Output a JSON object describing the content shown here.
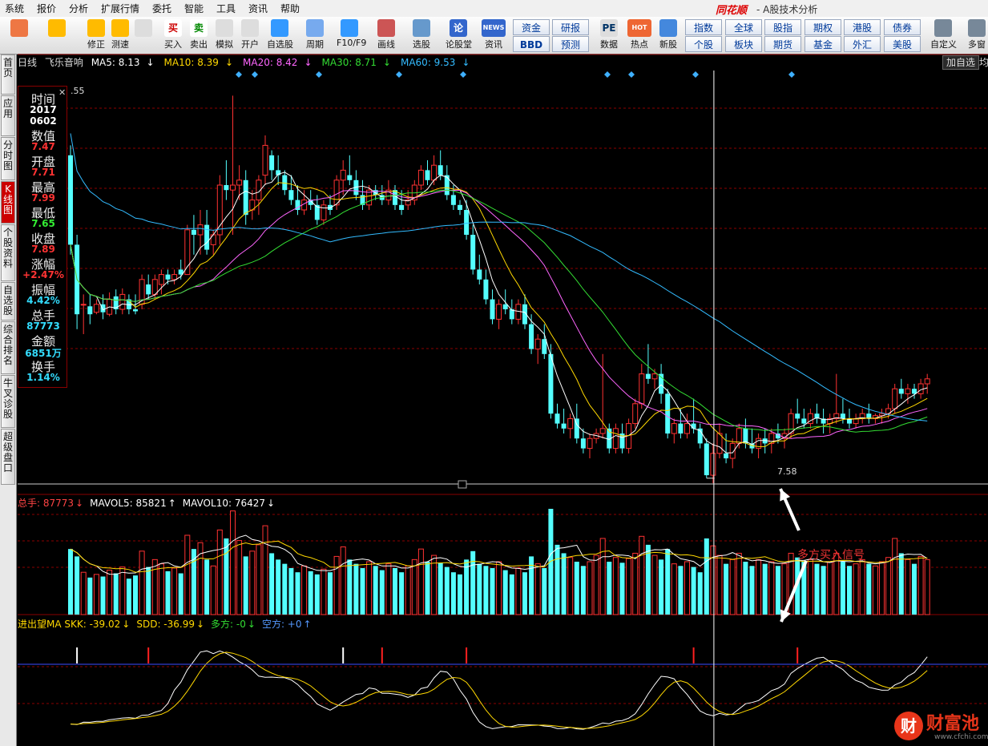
{
  "menu": [
    "系统",
    "报价",
    "分析",
    "扩展行情",
    "委托",
    "智能",
    "工具",
    "资讯",
    "帮助"
  ],
  "brand": "同花顺",
  "window_title": "- A股技术分析",
  "toolbar": {
    "tools": [
      {
        "label": "",
        "icon": "grid-icon"
      },
      {
        "label": "",
        "icon": "back-arrow-icon"
      },
      {
        "label": "修正",
        "icon": "up-down-arrow-icon"
      },
      {
        "label": "测速",
        "icon": "power-icon"
      },
      {
        "label": "",
        "icon": "clock-icon"
      },
      {
        "label": "买入",
        "icon": "buy-icon",
        "glyph": "买"
      },
      {
        "label": "卖出",
        "icon": "sell-icon",
        "glyph": "卖"
      },
      {
        "label": "模拟",
        "icon": "gavel-icon"
      },
      {
        "label": "开户",
        "icon": "lock-icon"
      },
      {
        "label": "自选股",
        "icon": "star-icon"
      },
      {
        "label": "周期",
        "icon": "cycle-icon"
      },
      {
        "label": "F10/F9",
        "icon": "f10-icon"
      },
      {
        "label": "画线",
        "icon": "pen-icon"
      },
      {
        "label": "选股",
        "icon": "monitor-icon"
      },
      {
        "label": "论股堂",
        "icon": "forum-icon",
        "glyph": "论"
      },
      {
        "label": "资讯",
        "icon": "news-icon",
        "glyph": "NEWS"
      },
      {
        "label": "数据",
        "icon": "pe-icon",
        "glyph": "PE"
      },
      {
        "label": "热点",
        "icon": "hot-icon",
        "glyph": "HOT"
      },
      {
        "label": "新股",
        "icon": "new-stock-icon"
      },
      {
        "label": "自定义",
        "icon": "custom-icon"
      },
      {
        "label": "多窗",
        "icon": "multi-window-icon"
      }
    ],
    "quick_row1": [
      "资金",
      "研报",
      "指数",
      "全球",
      "股指",
      "期权",
      "港股",
      "债券"
    ],
    "quick_row2": [
      "BBD",
      "预测",
      "个股",
      "板块",
      "期货",
      "基金",
      "外汇",
      "美股"
    ]
  },
  "sidebar": [
    "首页",
    "应用",
    "分时图",
    "K线图",
    "个股资料",
    "自选股",
    "综合排名",
    "牛叉诊股",
    "超级盘口"
  ],
  "chart_header": {
    "period": "日线",
    "stock": "飞乐音响",
    "ma": [
      {
        "label": "MA5: 8.13",
        "arrow": "↓",
        "color": "#ffffff"
      },
      {
        "label": "MA10: 8.39",
        "arrow": "↓",
        "color": "#ffd800"
      },
      {
        "label": "MA20: 8.42",
        "arrow": "↓",
        "color": "#ff66ff"
      },
      {
        "label": "MA30: 8.71",
        "arrow": "↓",
        "color": "#33dd33"
      },
      {
        "label": "MA60: 9.53",
        "arrow": "↓",
        "color": "#33bbff"
      }
    ],
    "add_fav": "加自选",
    "add_fav2": "均"
  },
  "price_top_label": ".55",
  "info_panel": [
    {
      "k": "时间",
      "v": "2017\n0602",
      "color": "#ffffff"
    },
    {
      "k": "数值",
      "v": "7.47",
      "color": "#ff3333"
    },
    {
      "k": "开盘",
      "v": "7.71",
      "color": "#ff3333"
    },
    {
      "k": "最高",
      "v": "7.99",
      "color": "#ff3333"
    },
    {
      "k": "最低",
      "v": "7.65",
      "color": "#33ee33"
    },
    {
      "k": "收盘",
      "v": "7.89",
      "color": "#ff3333"
    },
    {
      "k": "涨幅",
      "v": "+2.47%",
      "color": "#ff3333"
    },
    {
      "k": "振幅",
      "v": "4.42%",
      "color": "#33ddff"
    },
    {
      "k": "总手",
      "v": "87773",
      "color": "#33ddff"
    },
    {
      "k": "金额",
      "v": "6851万",
      "color": "#33ddff"
    },
    {
      "k": "换手",
      "v": "1.14%",
      "color": "#33ddff"
    }
  ],
  "low_label": "7.58",
  "volume_legend": [
    {
      "label": "总手: 87773",
      "arrow": "↓",
      "color": "#ff4444"
    },
    {
      "label": "MAVOL5: 85821",
      "arrow": "↑",
      "color": "#ffffff"
    },
    {
      "label": "MAVOL10: 76427",
      "arrow": "↓",
      "color": "#ffffff"
    }
  ],
  "indicator_legend": [
    {
      "label": "进出望MA SKK: -39.02",
      "arrow": "↓",
      "color": "#ffd800"
    },
    {
      "label": "SDD: -36.99",
      "arrow": "↓",
      "color": "#ffd800"
    },
    {
      "label": "多方: -0",
      "arrow": "↓",
      "color": "#33dd33"
    },
    {
      "label": "空方: +0",
      "arrow": "↑",
      "color": "#5599ff"
    }
  ],
  "signal_label": "多方买入信号",
  "watermark": {
    "text": "财富池",
    "url": "www.cfchi.com"
  },
  "colors": {
    "up": "#ff3232",
    "down": "#54ffff",
    "grid": "#8b0000",
    "crosshair": "#ffffff"
  },
  "chart_data": {
    "type": "candlestick",
    "title": "飞乐音响 日线",
    "ohlc": [
      [
        9.3,
        9.4,
        8.3,
        8.4
      ],
      [
        8.4,
        8.5,
        7.55,
        7.7
      ],
      [
        7.8,
        7.9,
        7.5,
        7.8
      ],
      [
        7.78,
        7.9,
        7.6,
        7.7
      ],
      [
        7.72,
        7.85,
        7.7,
        7.8
      ],
      [
        7.8,
        7.9,
        7.65,
        7.72
      ],
      [
        7.7,
        7.92,
        7.68,
        7.85
      ],
      [
        7.88,
        7.95,
        7.7,
        7.75
      ],
      [
        7.75,
        7.96,
        7.7,
        7.9
      ],
      [
        7.85,
        7.9,
        7.7,
        7.75
      ],
      [
        7.75,
        7.9,
        7.7,
        7.73
      ],
      [
        7.8,
        8.1,
        7.75,
        8.05
      ],
      [
        8.0,
        8.1,
        7.85,
        7.9
      ],
      [
        7.9,
        8.1,
        7.85,
        8.05
      ],
      [
        8.0,
        8.15,
        7.9,
        8.1
      ],
      [
        8.1,
        8.15,
        8.0,
        8.05
      ],
      [
        8.05,
        8.15,
        8.0,
        8.1
      ],
      [
        8.15,
        8.25,
        8.05,
        8.1
      ],
      [
        8.1,
        8.6,
        8.1,
        8.55
      ],
      [
        8.55,
        8.7,
        8.3,
        8.5
      ],
      [
        8.5,
        8.75,
        8.3,
        8.6
      ],
      [
        8.6,
        8.75,
        8.3,
        8.35
      ],
      [
        8.4,
        8.55,
        8.3,
        8.5
      ],
      [
        8.5,
        9.1,
        8.4,
        9.0
      ],
      [
        9.0,
        9.25,
        8.85,
        8.95
      ],
      [
        8.95,
        9.9,
        8.5,
        9.0
      ],
      [
        9.0,
        9.2,
        8.85,
        9.05
      ],
      [
        9.05,
        9.15,
        8.6,
        8.7
      ],
      [
        8.75,
        8.95,
        8.65,
        8.85
      ],
      [
        8.85,
        9.1,
        8.7,
        9.05
      ],
      [
        9.1,
        9.5,
        9.0,
        9.4
      ],
      [
        9.3,
        9.35,
        9.05,
        9.15
      ],
      [
        9.15,
        9.3,
        9.0,
        9.1
      ],
      [
        9.1,
        9.15,
        8.9,
        8.95
      ],
      [
        8.95,
        9.1,
        8.8,
        8.85
      ],
      [
        8.85,
        9.0,
        8.7,
        8.75
      ],
      [
        8.75,
        8.95,
        8.7,
        8.85
      ],
      [
        8.85,
        8.95,
        8.75,
        8.8
      ],
      [
        8.8,
        8.9,
        8.6,
        8.65
      ],
      [
        8.65,
        8.85,
        8.6,
        8.8
      ],
      [
        8.8,
        8.9,
        8.7,
        8.75
      ],
      [
        8.8,
        9.1,
        8.75,
        9.05
      ],
      [
        9.05,
        9.25,
        8.9,
        9.15
      ],
      [
        9.1,
        9.3,
        9.0,
        9.05
      ],
      [
        9.05,
        9.15,
        8.85,
        8.9
      ],
      [
        8.9,
        9.05,
        8.75,
        8.8
      ],
      [
        8.8,
        9.0,
        8.75,
        8.95
      ],
      [
        8.95,
        9.0,
        8.85,
        8.9
      ],
      [
        8.9,
        9.0,
        8.8,
        8.85
      ],
      [
        8.85,
        9.05,
        8.8,
        8.95
      ],
      [
        8.95,
        9.0,
        8.75,
        8.8
      ],
      [
        8.8,
        8.95,
        8.7,
        8.75
      ],
      [
        8.8,
        8.95,
        8.75,
        8.85
      ],
      [
        8.85,
        9.05,
        8.8,
        9.0
      ],
      [
        9.0,
        9.2,
        8.95,
        9.15
      ],
      [
        9.15,
        9.25,
        9.0,
        9.05
      ],
      [
        9.05,
        9.3,
        9.0,
        9.2
      ],
      [
        9.2,
        9.35,
        9.05,
        9.1
      ],
      [
        9.1,
        9.2,
        8.85,
        8.9
      ],
      [
        8.9,
        9.0,
        8.75,
        8.8
      ],
      [
        8.8,
        8.85,
        8.7,
        8.75
      ],
      [
        8.75,
        8.85,
        8.45,
        8.5
      ],
      [
        8.5,
        8.6,
        8.1,
        8.15
      ],
      [
        8.15,
        8.3,
        8.0,
        8.05
      ],
      [
        8.05,
        8.15,
        7.8,
        7.85
      ],
      [
        7.85,
        7.95,
        7.6,
        7.65
      ],
      [
        7.65,
        7.85,
        7.55,
        7.8
      ],
      [
        7.8,
        7.95,
        7.7,
        7.75
      ],
      [
        7.75,
        7.85,
        7.6,
        7.65
      ],
      [
        7.65,
        7.85,
        7.6,
        7.8
      ],
      [
        7.8,
        7.9,
        7.55,
        7.6
      ],
      [
        7.6,
        7.7,
        7.3,
        7.35
      ],
      [
        7.35,
        7.5,
        7.2,
        7.45
      ],
      [
        7.45,
        7.6,
        7.25,
        7.3
      ],
      [
        7.3,
        7.4,
        6.65,
        6.7
      ],
      [
        6.7,
        6.8,
        6.55,
        6.6
      ],
      [
        6.6,
        6.75,
        6.5,
        6.55
      ],
      [
        6.55,
        6.7,
        6.45,
        6.65
      ],
      [
        6.65,
        6.8,
        6.4,
        6.45
      ],
      [
        6.45,
        6.55,
        6.3,
        6.35
      ],
      [
        6.35,
        6.5,
        6.25,
        6.45
      ],
      [
        6.45,
        6.55,
        6.4,
        6.5
      ],
      [
        6.5,
        7.3,
        6.45,
        6.55
      ],
      [
        6.55,
        6.6,
        6.3,
        6.35
      ],
      [
        6.35,
        6.6,
        6.3,
        6.55
      ],
      [
        6.5,
        6.6,
        6.3,
        6.35
      ],
      [
        6.35,
        6.65,
        6.3,
        6.6
      ],
      [
        6.6,
        6.85,
        6.55,
        6.8
      ],
      [
        6.8,
        7.2,
        6.75,
        7.1
      ],
      [
        7.1,
        7.4,
        7.0,
        7.05
      ],
      [
        7.05,
        7.15,
        6.95,
        7.1
      ],
      [
        7.1,
        7.2,
        6.8,
        6.9
      ],
      [
        6.9,
        6.95,
        6.45,
        6.5
      ],
      [
        6.5,
        6.65,
        6.4,
        6.6
      ],
      [
        6.6,
        6.75,
        6.45,
        6.5
      ],
      [
        6.5,
        6.7,
        6.45,
        6.6
      ],
      [
        6.6,
        6.85,
        6.5,
        6.55
      ],
      [
        6.55,
        6.6,
        6.35,
        6.4
      ],
      [
        6.4,
        6.45,
        6.05,
        6.08
      ],
      [
        6.08,
        6.4,
        6.0,
        6.3
      ],
      [
        6.3,
        6.6,
        6.25,
        6.5
      ],
      [
        6.3,
        6.5,
        6.2,
        6.25
      ],
      [
        6.25,
        6.45,
        6.15,
        6.4
      ],
      [
        6.4,
        6.6,
        6.35,
        6.55
      ],
      [
        6.55,
        6.65,
        6.35,
        6.4
      ],
      [
        6.4,
        6.55,
        6.3,
        6.35
      ],
      [
        6.35,
        6.5,
        6.25,
        6.45
      ],
      [
        6.45,
        6.55,
        6.3,
        6.4
      ],
      [
        6.4,
        6.55,
        6.3,
        6.5
      ],
      [
        6.5,
        6.6,
        6.4,
        6.45
      ],
      [
        6.45,
        6.55,
        6.35,
        6.5
      ],
      [
        6.5,
        6.75,
        6.45,
        6.7
      ],
      [
        6.7,
        6.85,
        6.6,
        6.65
      ],
      [
        6.65,
        6.75,
        6.55,
        6.6
      ],
      [
        6.6,
        6.75,
        6.55,
        6.7
      ],
      [
        6.7,
        6.8,
        6.6,
        6.65
      ],
      [
        6.65,
        6.75,
        6.5,
        6.6
      ],
      [
        6.6,
        6.7,
        6.5,
        6.65
      ],
      [
        6.65,
        7.1,
        6.6,
        6.7
      ],
      [
        6.7,
        6.85,
        6.6,
        6.65
      ],
      [
        6.65,
        6.75,
        6.55,
        6.6
      ],
      [
        6.6,
        6.7,
        6.55,
        6.65
      ],
      [
        6.65,
        6.75,
        6.6,
        6.7
      ],
      [
        6.7,
        6.8,
        6.6,
        6.65
      ],
      [
        6.65,
        6.7,
        6.6,
        6.68
      ],
      [
        6.68,
        6.75,
        6.6,
        6.7
      ],
      [
        6.7,
        6.8,
        6.65,
        6.75
      ],
      [
        6.75,
        7.0,
        6.7,
        6.95
      ],
      [
        6.95,
        7.05,
        6.85,
        6.9
      ],
      [
        6.9,
        7.0,
        6.8,
        6.95
      ],
      [
        6.95,
        7.0,
        6.85,
        6.9
      ],
      [
        6.9,
        7.05,
        6.85,
        7.0
      ],
      [
        7.0,
        7.1,
        6.9,
        7.05
      ]
    ],
    "volume": [
      62,
      55,
      40,
      35,
      38,
      36,
      42,
      39,
      45,
      34,
      37,
      60,
      45,
      52,
      48,
      41,
      44,
      39,
      75,
      62,
      68,
      52,
      46,
      80,
      72,
      98,
      70,
      55,
      60,
      66,
      84,
      58,
      52,
      48,
      44,
      40,
      46,
      41,
      38,
      43,
      40,
      55,
      64,
      52,
      48,
      44,
      50,
      46,
      42,
      48,
      44,
      40,
      46,
      52,
      62,
      50,
      56,
      49,
      45,
      40,
      38,
      52,
      60,
      48,
      46,
      44,
      50,
      42,
      38,
      44,
      40,
      55,
      48,
      44,
      100,
      66,
      58,
      54,
      50,
      46,
      50,
      56,
      72,
      50,
      54,
      49,
      53,
      58,
      74,
      66,
      56,
      52,
      62,
      48,
      46,
      50,
      45,
      40,
      72,
      65,
      56,
      48,
      52,
      58,
      50,
      46,
      52,
      48,
      50,
      46,
      48,
      58,
      54,
      50,
      52,
      48,
      46,
      50,
      58,
      50,
      46,
      48,
      52,
      48,
      46,
      50,
      54,
      72,
      58,
      52,
      48,
      55,
      52
    ],
    "crosshair_index": 99,
    "ma_legend": [
      "MA5",
      "MA10",
      "MA20",
      "MA30",
      "MA60"
    ]
  }
}
